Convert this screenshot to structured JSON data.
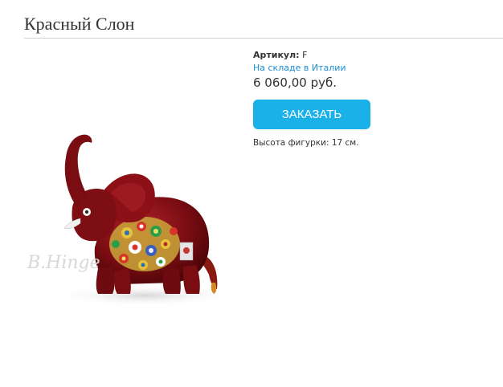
{
  "product": {
    "title": "Красный Слон",
    "sku_label": "Артикул:",
    "sku_value": "F",
    "stock_status": "На складе в Италии",
    "price": "6 060,00 руб.",
    "order_button_label": "ЗАКАЗАТЬ",
    "height_note": "Высота фигурки: 17 см.",
    "image_watermark": "B.Hinge"
  },
  "colors": {
    "accent": "#1ab0e8",
    "link": "#1a8fd4",
    "elephant_body": "#7a0d12"
  }
}
